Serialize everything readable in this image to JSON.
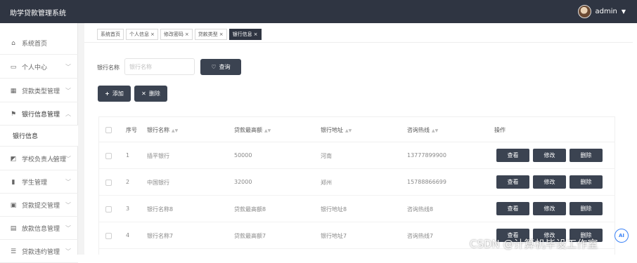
{
  "app": {
    "title": "助学贷款管理系统"
  },
  "user": {
    "name": "admin"
  },
  "sidebar": {
    "items": [
      {
        "label": "系统首页",
        "icon": "home-icon"
      },
      {
        "label": "个人中心",
        "icon": "window-icon"
      },
      {
        "label": "贷款类型管理",
        "icon": "grid-icon"
      },
      {
        "label": "银行信息管理",
        "icon": "flag-icon"
      },
      {
        "label": "学校负责人管理",
        "icon": "chart-icon"
      },
      {
        "label": "学生管理",
        "icon": "bar-chart-icon"
      },
      {
        "label": "贷款提交管理",
        "icon": "wallet-icon"
      },
      {
        "label": "放款信息管理",
        "icon": "clipboard-icon"
      },
      {
        "label": "贷款违约管理",
        "icon": "list-icon"
      }
    ],
    "submenu": [
      {
        "label": "银行信息"
      }
    ]
  },
  "tabs": [
    {
      "label": "系统首页",
      "closable": false,
      "active": false
    },
    {
      "label": "个人信息",
      "closable": true,
      "active": false
    },
    {
      "label": "修改密码",
      "closable": true,
      "active": false
    },
    {
      "label": "贷款类型",
      "closable": true,
      "active": false
    },
    {
      "label": "银行信息",
      "closable": true,
      "active": true
    }
  ],
  "search": {
    "label": "银行名称",
    "placeholder": "银行名称",
    "query_button": "查询"
  },
  "toolbar": {
    "add_label": "添加",
    "delete_label": "删除"
  },
  "table": {
    "headers": [
      "序号",
      "银行名称",
      "贷款最高额",
      "银行地址",
      "咨询热线",
      "操作"
    ],
    "rows": [
      [
        "1",
        "插平银行",
        "50000",
        "河南",
        "13777899900"
      ],
      [
        "2",
        "中国银行",
        "32000",
        "郑州",
        "15788866699"
      ],
      [
        "3",
        "银行名称8",
        "贷款最高额8",
        "银行地址8",
        "咨询热线8"
      ],
      [
        "4",
        "银行名称7",
        "贷款最高额7",
        "银行地址7",
        "咨询热线7"
      ]
    ],
    "actions": [
      "查看",
      "修改",
      "删除"
    ]
  },
  "watermark": "CSDN @计算机毕设工作室",
  "float_button": "AI",
  "colors": {
    "topbar": "#2f3542",
    "button": "#3b4351",
    "active_tab": "#2f3542"
  }
}
